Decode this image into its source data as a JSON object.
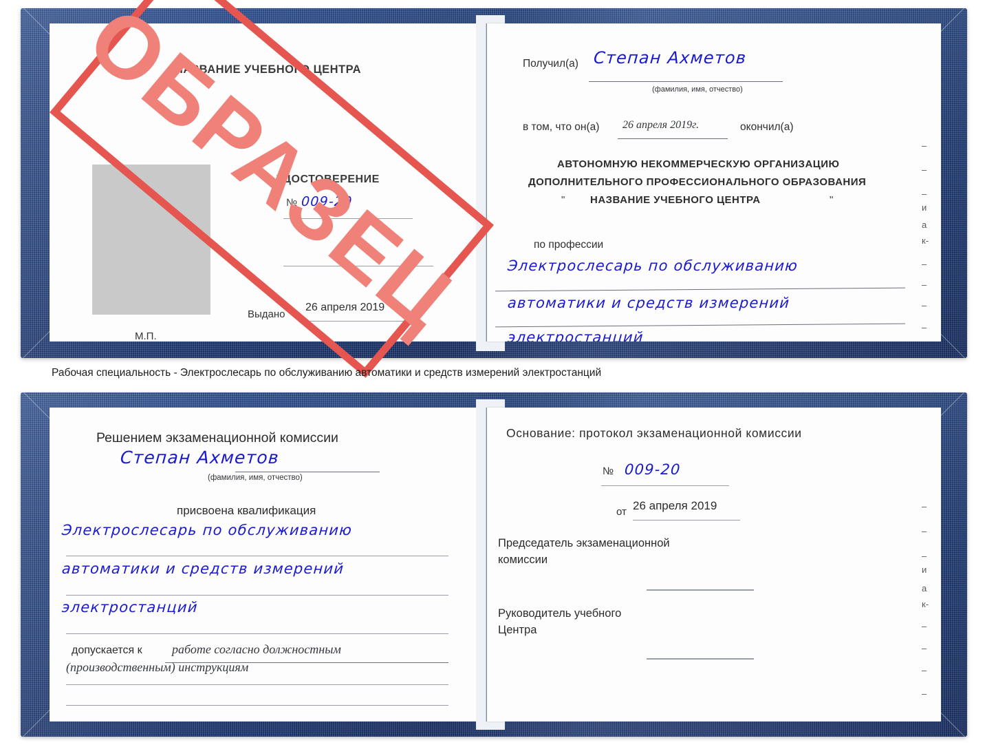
{
  "caption": "Рабочая специальность - Электрослесарь по обслуживанию автоматики и средств измерений электростанций",
  "colors": {
    "cover_blue": "#22407f",
    "stamp_red": "#e4564f",
    "stamp_text_red": "#ef8179",
    "handwriting_blue": "#1a1ad0",
    "photo_placeholder_gray": "#c9c9c9",
    "rule_gray": "#9a9ea6"
  },
  "watermark": {
    "text": "ОБРАЗЕЦ"
  },
  "doc1": {
    "left_page": {
      "header": "НАЗВАНИЕ УЧЕБНОГО ЦЕНТРА",
      "title": "УДОСТОВЕРЕНИЕ",
      "number_label": "№",
      "number_value": "009-20",
      "issued_label": "Выдано",
      "issued_value": "26 апреля 2019",
      "seal_label": "М.П."
    },
    "right_page": {
      "received_label": "Получил(а)",
      "received_value": "Степан Ахметов",
      "name_hint": "(фамилия, имя, отчество)",
      "in_that_label": "в том, что он(а)",
      "completion_date": "26 апреля 2019г.",
      "finished_label": "окончил(а)",
      "org_line1": "АВТОНОМНУЮ НЕКОММЕРЧЕСКУЮ ОРГАНИЗАЦИЮ",
      "org_line2": "ДОПОЛНИТЕЛЬНОГО ПРОФЕССИОНАЛЬНОГО ОБРАЗОВАНИЯ",
      "org_quote_open": "\"",
      "org_line3": "НАЗВАНИЕ УЧЕБНОГО ЦЕНТРА",
      "org_quote_close": "\"",
      "profession_label": "по профессии",
      "profession_line1": "Электрослесарь по обслуживанию",
      "profession_line2": "автоматики и средств измерений",
      "profession_line3": "электростанций",
      "edge_marks": [
        "–",
        "–",
        "–",
        "и",
        "а",
        "к-",
        "–",
        "–",
        "–",
        "–"
      ]
    }
  },
  "doc2": {
    "left_page": {
      "header": "Решением экзаменационной комиссии",
      "name_value": "Степан Ахметов",
      "name_hint": "(фамилия, имя, отчество)",
      "qualification_label": "присвоена квалификация",
      "qualification_line1": "Электрослесарь по обслуживанию",
      "qualification_line2": "автоматики и средств измерений",
      "qualification_line3": "электростанций",
      "admitted_label": "допускается к",
      "admitted_value_line1": "работе согласно должностным",
      "admitted_value_line2": "(производственным) инструкциям"
    },
    "right_page": {
      "basis_label": "Основание: протокол экзаменационной комиссии",
      "number_label": "№",
      "number_value": "009-20",
      "date_label": "от",
      "date_value": "26 апреля 2019",
      "chairman_line1": "Председатель экзаменационной",
      "chairman_line2": "комиссии",
      "head_line1": "Руководитель учебного",
      "head_line2": "Центра",
      "edge_marks": [
        "–",
        "–",
        "–",
        "и",
        "а",
        "к-",
        "–",
        "–",
        "–",
        "–"
      ]
    }
  }
}
